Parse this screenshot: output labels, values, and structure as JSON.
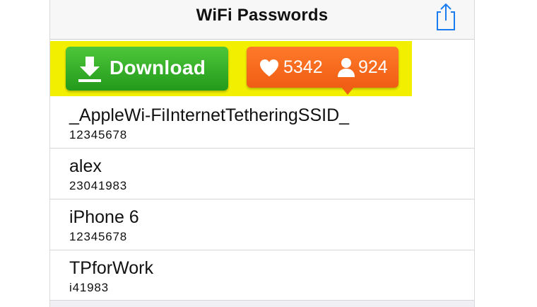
{
  "navbar": {
    "title": "WiFi Passwords",
    "share_icon": "share-icon"
  },
  "ad": {
    "download_label": "Download",
    "download_icon": "download-arrow-icon",
    "likes": "5342",
    "users": "924",
    "heart_icon": "heart-icon",
    "user_icon": "user-icon",
    "colors": {
      "banner": "#f2f000",
      "download": "#2fae25",
      "stats": "#f56a1e"
    }
  },
  "networks": [
    {
      "ssid": "_AppleWi-FiInternetTetheringSSID_",
      "password": "12345678"
    },
    {
      "ssid": "alex",
      "password": "23041983"
    },
    {
      "ssid": "iPhone 6",
      "password": "12345678"
    },
    {
      "ssid": "TPforWork",
      "password": "i41983"
    }
  ]
}
